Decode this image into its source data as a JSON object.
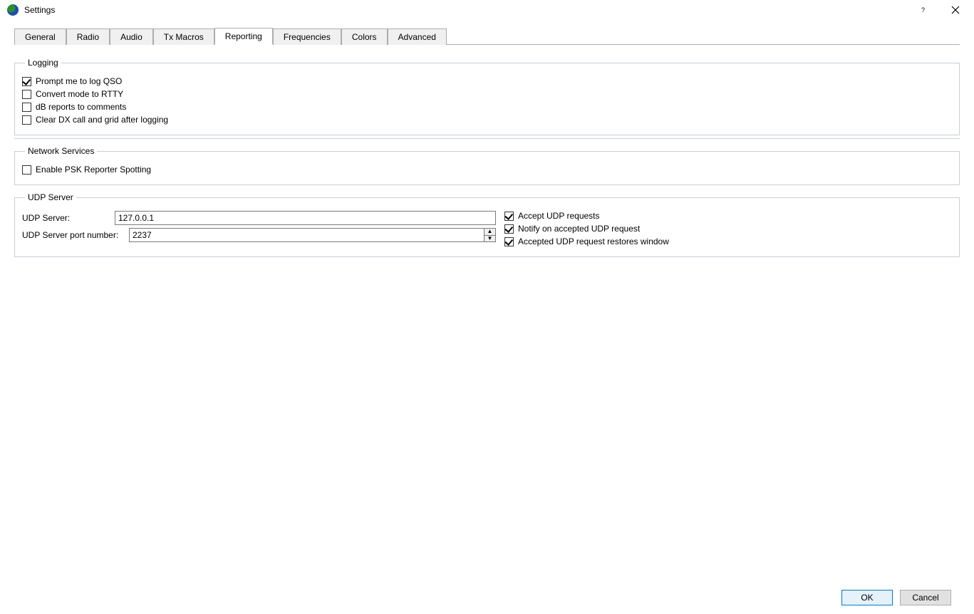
{
  "window_title": "Settings",
  "tabs": [
    "General",
    "Radio",
    "Audio",
    "Tx Macros",
    "Reporting",
    "Frequencies",
    "Colors",
    "Advanced"
  ],
  "active_tab": "Reporting",
  "logging": {
    "legend": "Logging",
    "prompt_qso": {
      "label": "Prompt me to log QSO",
      "checked": true
    },
    "convert_rtty": {
      "label": "Convert mode to RTTY",
      "checked": false
    },
    "db_comments": {
      "label": "dB reports to comments",
      "checked": false
    },
    "clear_dx": {
      "label": "Clear DX call and grid after logging",
      "checked": false
    }
  },
  "network": {
    "legend": "Network Services",
    "psk_reporter": {
      "label": "Enable PSK Reporter Spotting",
      "checked": false
    }
  },
  "udp": {
    "legend": "UDP Server",
    "server_label": "UDP Server:",
    "server_value": "127.0.0.1",
    "port_label": "UDP Server port number:",
    "port_value": "2237",
    "accept": {
      "label": "Accept UDP requests",
      "checked": true
    },
    "notify": {
      "label": "Notify on accepted UDP request",
      "checked": true
    },
    "restore": {
      "label": "Accepted UDP request restores window",
      "checked": true
    }
  },
  "buttons": {
    "ok": "OK",
    "cancel": "Cancel"
  }
}
